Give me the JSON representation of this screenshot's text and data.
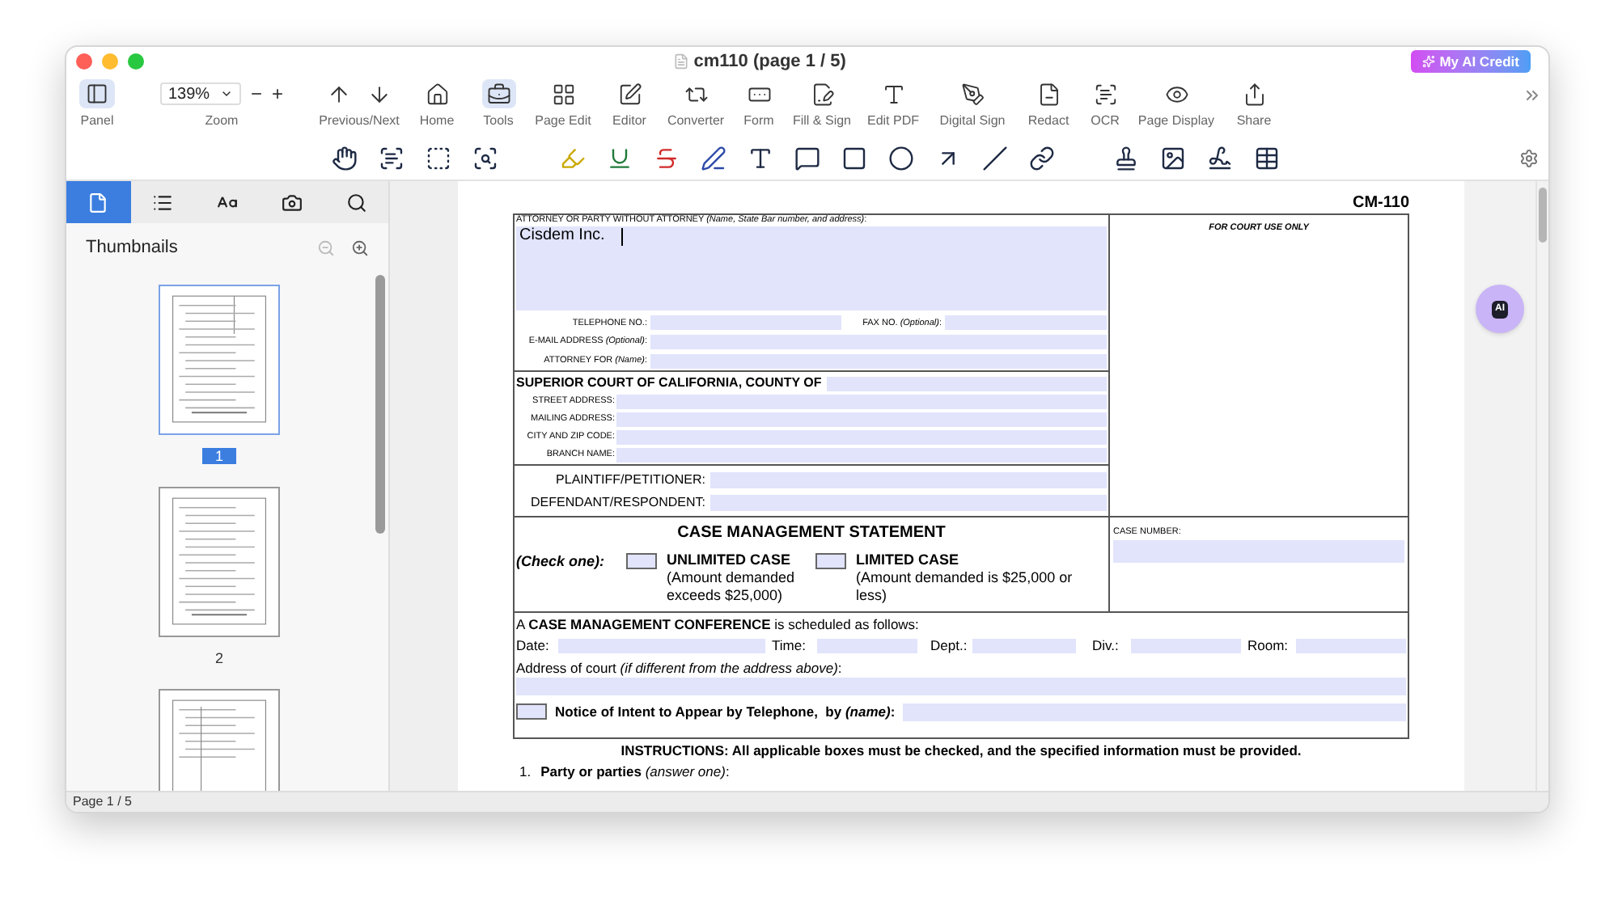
{
  "window": {
    "title": "cm110 (page 1 / 5)",
    "ai_credit": "My AI Credit"
  },
  "toolbar": {
    "panel": {
      "label": "Panel",
      "on": true
    },
    "zoom": {
      "value": "139%",
      "label": "Zoom",
      "minus": "−",
      "plus": "+"
    },
    "items": [
      {
        "label": "Previous/Next",
        "selected": false
      },
      {
        "label": "Home",
        "selected": false
      },
      {
        "label": "Tools",
        "selected": true
      },
      {
        "label": "Page Edit",
        "selected": false
      },
      {
        "label": "Editor",
        "selected": false
      },
      {
        "label": "Converter",
        "selected": false
      },
      {
        "label": "Form",
        "selected": false
      },
      {
        "label": "Fill & Sign",
        "selected": false
      },
      {
        "label": "Edit PDF",
        "selected": false
      },
      {
        "label": "Digital Sign",
        "selected": false
      },
      {
        "label": "Redact",
        "selected": false
      },
      {
        "label": "OCR",
        "selected": false
      },
      {
        "label": "Page Display",
        "selected": false
      },
      {
        "label": "Share",
        "selected": false
      }
    ]
  },
  "sidebar": {
    "tabs": [
      {
        "selected": true
      },
      {
        "selected": false
      },
      {
        "selected": false
      },
      {
        "selected": false
      },
      {
        "selected": false
      }
    ],
    "title": "Thumbnails",
    "thumbnails": [
      {
        "label": "1",
        "selected": true
      },
      {
        "label": "2",
        "selected": false
      },
      {
        "selected": false
      }
    ]
  },
  "document": {
    "form_code": "CM-110",
    "attorney_label": "ATTORNEY OR PARTY WITHOUT ATTORNEY *(Name, State Bar number, and address)*:",
    "attorney_value": "Cisdem Inc.",
    "telephone_label": "TELEPHONE NO.:",
    "fax_label": "FAX NO. *(Optional)*:",
    "email_label": "E-MAIL ADDRESS *(Optional)*:",
    "attorney_for_label": "ATTORNEY FOR *(Name)*:",
    "court_use_label": "FOR COURT USE ONLY",
    "court_heading": "SUPERIOR COURT OF CALIFORNIA, COUNTY OF",
    "court_fields": [
      "STREET ADDRESS:",
      "MAILING ADDRESS:",
      "CITY AND ZIP CODE:",
      "BRANCH NAME:"
    ],
    "parties": [
      "PLAINTIFF/PETITIONER:",
      "DEFENDANT/RESPONDENT:"
    ],
    "statement_title": "CASE MANAGEMENT STATEMENT",
    "check_one": "(Check one):",
    "case_types": [
      {
        "title": "UNLIMITED CASE",
        "description": "(Amount demanded exceeds $25,000)",
        "checked": false
      },
      {
        "title": "LIMITED CASE",
        "description": "(Amount demanded is $25,000 or less)",
        "checked": false
      }
    ],
    "case_number_label": "CASE NUMBER:",
    "conference_text": "A **CASE MANAGEMENT CONFERENCE** is scheduled as follows:",
    "schedule_fields": [
      "Date:",
      "Time:",
      "Dept.:",
      "Div.:",
      "Room:"
    ],
    "address_label": "Address of court *(if different from the address above)*:",
    "telephone_notice": {
      "text": "Notice of Intent to Appear by Telephone,  by *(name)*:",
      "checked": false
    },
    "instructions": "INSTRUCTIONS: All applicable boxes must be checked, and the specified information must be provided.",
    "item_number": "1.",
    "item_text": "**Party or parties** *(answer one)*:"
  },
  "ai_button": "AI",
  "status_bar": "Page 1 / 5"
}
